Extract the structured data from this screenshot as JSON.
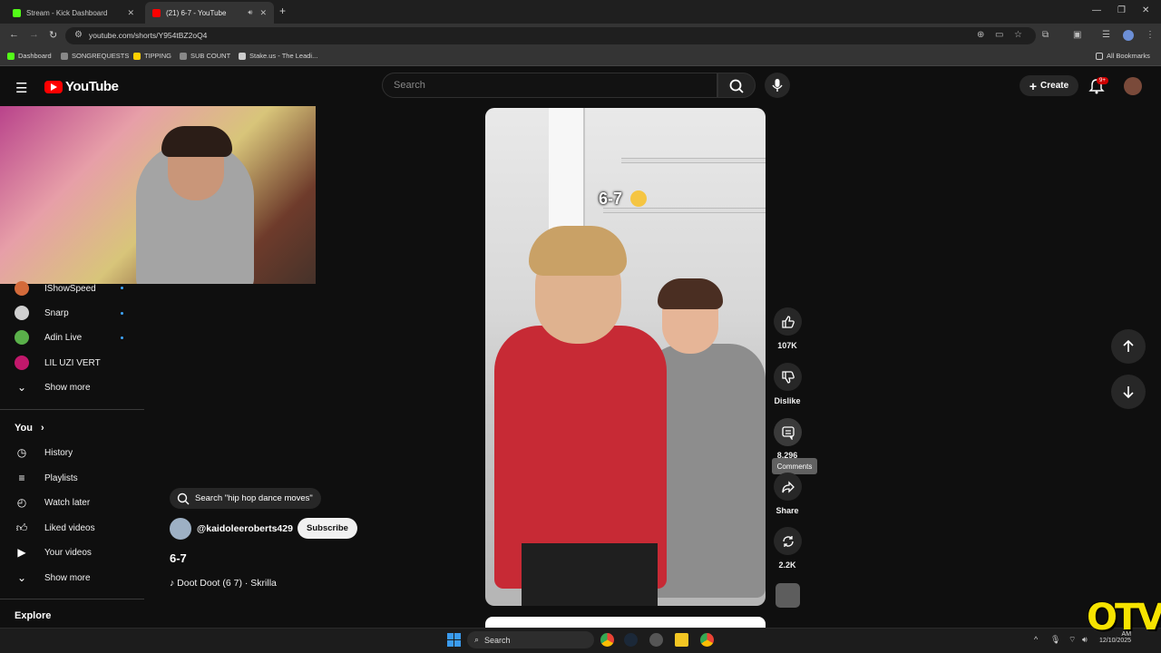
{
  "browser": {
    "tabs": [
      {
        "title": "Stream - Kick Dashboard",
        "color": "#53fc18"
      },
      {
        "title": "(21) 6-7 - YouTube",
        "color": "#ff0000"
      }
    ],
    "url": "youtube.com/shorts/Y954tBZ2oQ4",
    "bookmarks": [
      {
        "label": "Dashboard",
        "color": "#53fc18"
      },
      {
        "label": "SONGREQUESTS",
        "color": "#888888"
      },
      {
        "label": "TIPPING",
        "color": "#ffd000"
      },
      {
        "label": "SUB COUNT",
        "color": "#888888"
      },
      {
        "label": "Stake.us - The Leadi...",
        "color": "#cccccc"
      }
    ],
    "all_bookmarks": "All Bookmarks"
  },
  "header": {
    "logo": "YouTube",
    "search_placeholder": "Search",
    "create": "Create",
    "notif_badge": "9+"
  },
  "sidebar": {
    "subscriptions": [
      {
        "name": "IShowSpeed",
        "color": "#d36a3a"
      },
      {
        "name": "Snarp",
        "color": "#cfcfcf"
      },
      {
        "name": "Adin Live",
        "color": "#5ab04a"
      },
      {
        "name": "LIL UZI VERT",
        "color": "#c2186b"
      }
    ],
    "show_more": "Show more",
    "you": "You",
    "you_items": [
      "History",
      "Playlists",
      "Watch later",
      "Liked videos",
      "Your videos"
    ],
    "show_more_2": "Show more",
    "explore": "Explore"
  },
  "short": {
    "search_chip": "Search \"hip hop dance moves\"",
    "channel": "@kaidoleeroberts429",
    "subscribe": "Subscribe",
    "title": "6-7",
    "music": "Doot Doot (6 7) · Skrilla",
    "overlay_caption": "6-7"
  },
  "actions": {
    "likes": "107K",
    "dislike": "Dislike",
    "comments": "8,296",
    "tooltip": "Comments",
    "share": "Share",
    "remix": "2.2K"
  },
  "taskbar": {
    "search": "Search",
    "time": "AM",
    "date": "12/10/2025"
  },
  "watermark": "OTV"
}
